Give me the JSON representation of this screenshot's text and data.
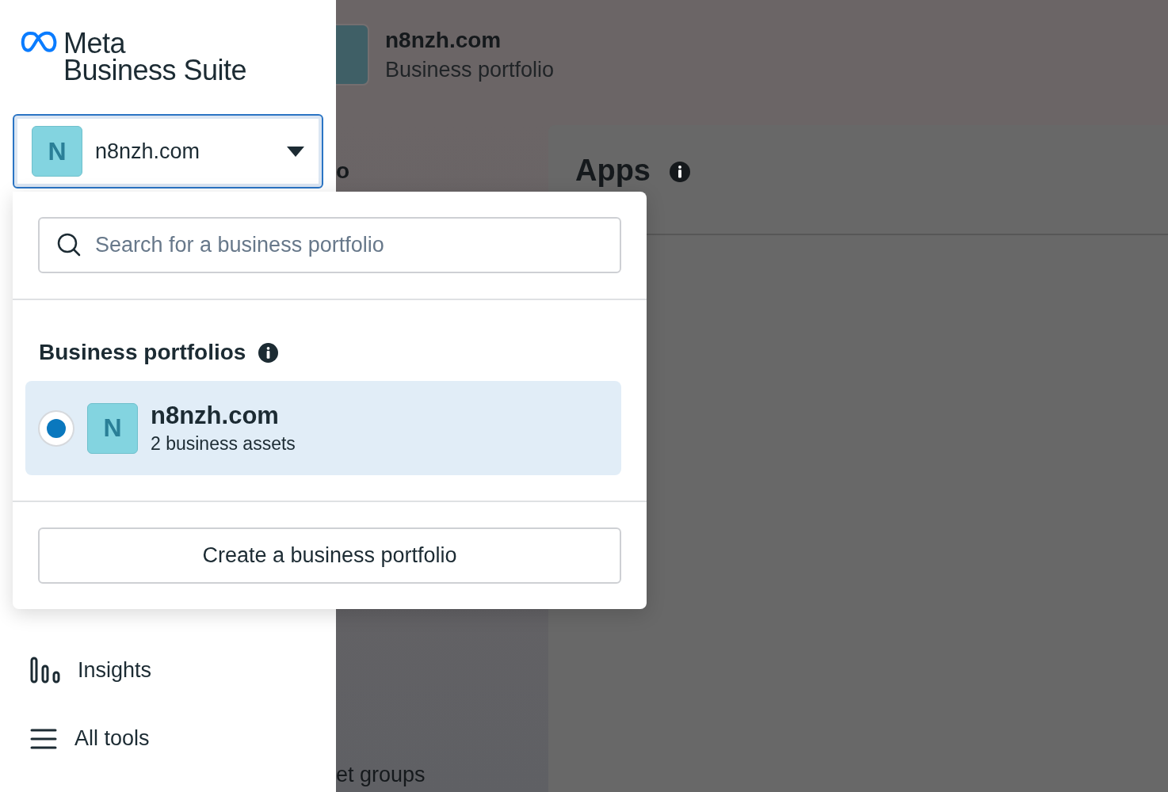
{
  "brand": {
    "line1": "Meta",
    "line2": "Business Suite"
  },
  "account_selector": {
    "avatar": "N",
    "name": "n8nzh.com",
    "expanded": true
  },
  "nav": [
    {
      "kind": "insights",
      "label": "Insights"
    },
    {
      "kind": "menu",
      "label": "All tools"
    }
  ],
  "page_header": {
    "title": "n8nzh.com",
    "subtitle": "Business portfolio"
  },
  "left_column": {
    "heading_fragment": "o",
    "footer_fragment": "et groups"
  },
  "apps_card": {
    "title": "Apps"
  },
  "dropdown": {
    "search": {
      "placeholder": "Search for a business portfolio"
    },
    "section_title": "Business portfolios",
    "portfolios": [
      {
        "avatar": "N",
        "name": "n8nzh.com",
        "detail": "2 business assets",
        "selected": true
      }
    ],
    "create_button": "Create a business portfolio"
  }
}
